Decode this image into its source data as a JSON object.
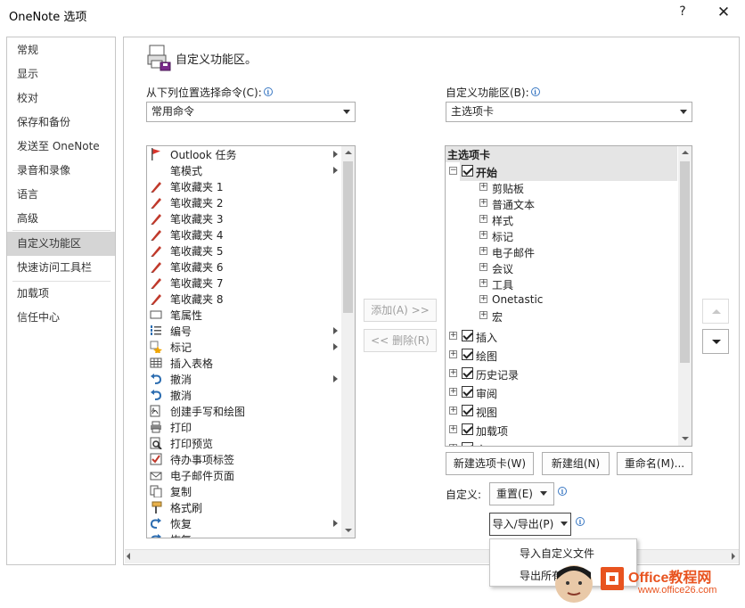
{
  "window": {
    "title": "OneNote 选项",
    "help_glyph": "?",
    "close_glyph": "✕"
  },
  "nav": {
    "items": [
      {
        "label": "常规",
        "active": false
      },
      {
        "label": "显示",
        "active": false
      },
      {
        "label": "校对",
        "active": false
      },
      {
        "label": "保存和备份",
        "active": false
      },
      {
        "label": "发送至 OneNote",
        "active": false
      },
      {
        "label": "录音和录像",
        "active": false
      },
      {
        "label": "语言",
        "active": false
      },
      {
        "label": "高级",
        "active": false
      },
      {
        "label": "自定义功能区",
        "active": true
      },
      {
        "label": "快速访问工具栏",
        "active": false
      },
      {
        "label": "加载项",
        "active": false
      },
      {
        "label": "信任中心",
        "active": false
      }
    ]
  },
  "header": {
    "title": "自定义功能区。"
  },
  "left": {
    "label": "从下列位置选择命令(C):",
    "combo_value": "常用命令",
    "commands": [
      {
        "label": "Outlook 任务",
        "icon": "flag-icon",
        "submenu": true
      },
      {
        "label": "笔模式",
        "icon": "",
        "submenu": true
      },
      {
        "label": "笔收藏夹 1",
        "icon": "pen-icon",
        "submenu": false
      },
      {
        "label": "笔收藏夹 2",
        "icon": "pen-icon",
        "submenu": false
      },
      {
        "label": "笔收藏夹 3",
        "icon": "pen-icon",
        "submenu": false
      },
      {
        "label": "笔收藏夹 4",
        "icon": "pen-icon",
        "submenu": false
      },
      {
        "label": "笔收藏夹 5",
        "icon": "pen-icon",
        "submenu": false
      },
      {
        "label": "笔收藏夹 6",
        "icon": "pen-icon",
        "submenu": false
      },
      {
        "label": "笔收藏夹 7",
        "icon": "pen-icon",
        "submenu": false
      },
      {
        "label": "笔收藏夹 8",
        "icon": "pen-icon",
        "submenu": false
      },
      {
        "label": "笔属性",
        "icon": "rectangle-icon",
        "submenu": false
      },
      {
        "label": "编号",
        "icon": "numbered-list-icon",
        "submenu": true
      },
      {
        "label": "标记",
        "icon": "tag-star-icon",
        "submenu": true
      },
      {
        "label": "插入表格",
        "icon": "table-icon",
        "submenu": false
      },
      {
        "label": "撤消",
        "icon": "undo-icon",
        "submenu": true
      },
      {
        "label": "撤消",
        "icon": "undo-icon",
        "submenu": false
      },
      {
        "label": "创建手写和绘图",
        "icon": "ink-draw-icon",
        "submenu": false
      },
      {
        "label": "打印",
        "icon": "printer-icon",
        "submenu": false
      },
      {
        "label": "打印预览",
        "icon": "print-preview-icon",
        "submenu": false
      },
      {
        "label": "待办事项标签",
        "icon": "checkbox-tag-icon",
        "submenu": false
      },
      {
        "label": "电子邮件页面",
        "icon": "email-icon",
        "submenu": false
      },
      {
        "label": "复制",
        "icon": "copy-icon",
        "submenu": false
      },
      {
        "label": "格式刷",
        "icon": "format-painter-icon",
        "submenu": false
      },
      {
        "label": "恢复",
        "icon": "redo-icon",
        "submenu": true
      },
      {
        "label": "恢复",
        "icon": "redo-icon",
        "submenu": false
      }
    ]
  },
  "middle": {
    "add_label": "添加(A) >>",
    "remove_label": "<< 删除(R)"
  },
  "right": {
    "label": "自定义功能区(B):",
    "combo_value": "主选项卡",
    "tree_header": "主选项卡",
    "tabs": [
      {
        "label": "开始",
        "expanded": true,
        "checked": true,
        "groups": [
          "剪贴板",
          "普通文本",
          "样式",
          "标记",
          "电子邮件",
          "会议",
          "工具",
          "Onetastic",
          "宏"
        ]
      },
      {
        "label": "插入",
        "expanded": false,
        "checked": true
      },
      {
        "label": "绘图",
        "expanded": false,
        "checked": true
      },
      {
        "label": "历史记录",
        "expanded": false,
        "checked": true
      },
      {
        "label": "审阅",
        "expanded": false,
        "checked": true
      },
      {
        "label": "视图",
        "expanded": false,
        "checked": true
      },
      {
        "label": "加载项",
        "expanded": false,
        "checked": true
      },
      {
        "label": "宏",
        "expanded": false,
        "checked": true
      }
    ],
    "buttons": {
      "new_tab": "新建选项卡(W)",
      "new_group": "新建组(N)",
      "rename": "重命名(M)..."
    },
    "customize_label": "自定义:",
    "reset_label": "重置(E)",
    "import_export_label": "导入/导出(P)"
  },
  "dropdown": {
    "items": [
      "导入自定义文件",
      "导出所有"
    ]
  },
  "watermark": {
    "brand": "Office教程网",
    "url": "www.office26.com"
  },
  "colors": {
    "active_nav": "#d5d5d5",
    "info_blue": "#3a78c3",
    "selection": "#e5e5e5",
    "watermark_orange": "#e8531f"
  }
}
